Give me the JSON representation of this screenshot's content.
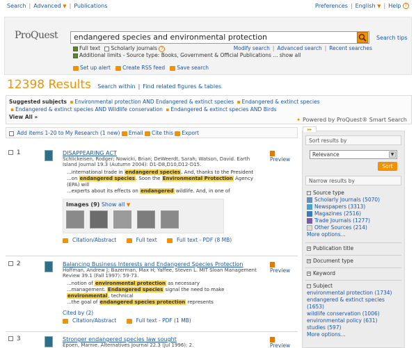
{
  "header": {
    "search": "Search",
    "advanced": "Advanced",
    "publications": "Publications",
    "preferences": "Preferences",
    "language": "English",
    "help": "Help"
  },
  "logo": "ProQuest",
  "search": {
    "query": "endangered species and environmental protection",
    "tips": "Search tips",
    "full_text": "Full text",
    "scholarly": "Scholarly journals",
    "additional_limits": "Additional limits - Source type: Books, Government & Official Publications ... show all",
    "modify": "Modify search",
    "advanced_search": "Advanced search",
    "recent": "Recent searches",
    "set_alert": "Set up alert",
    "rss": "Create RSS feed",
    "save": "Save search"
  },
  "results": {
    "count": "12398 Results",
    "search_within": "Search within",
    "find_related": "Find related figures & tables"
  },
  "suggested": {
    "label": "Suggested subjects",
    "items": [
      "Environmental protection AND Endangered & extinct species",
      "Endangered & extinct species",
      "Endangered & extinct species AND Wildlife conservation",
      "Endangered & extinct species AND Birds"
    ],
    "view_all": "View All »",
    "powered_by": "Powered by ProQuest® Smart Search"
  },
  "list_header": {
    "add_items": "Add items 1-20 to My Research (1 new)",
    "email": "Email",
    "cite": "Cite this",
    "export": "Export"
  },
  "items": [
    {
      "num": "1",
      "title": "DISAPPEARING ACT",
      "meta": "Schlickeisen, Rodger; Nowicki, Brian; DeWeerdt, Sarah; Watson, David. Earth Island Journal 19.3 (Autumn 2004): D1-D8,D10,D12-D15.",
      "preview": "Preview",
      "images_label": "Images (9)",
      "show_all": "Show all",
      "links": [
        "Citation/Abstract",
        "Full text",
        "Full text - PDF (8 MB)"
      ]
    },
    {
      "num": "2",
      "title": "Balancing Business Interests and Endangered Species Protection",
      "meta": "Hoffman, Andrew J; Bazerman, Max H; Yaffee, Steven L. MIT Sloan Management Review 39.1 (Fall 1997): 59-73.",
      "preview": "Preview",
      "cited_by": "Cited by (2)",
      "links": [
        "Citation/Abstract",
        "Full text - PDF (1 MB)"
      ]
    },
    {
      "num": "3",
      "title": "Stronger endangered species law sought",
      "meta": "Epoen, Marnie. Alternatives Journal 22.3 (Jul 1996): 2.",
      "preview": "Preview"
    }
  ],
  "snippet1": {
    "l1a": "...international trade in ",
    "l1h": "endangered species",
    "l1b": ". And, thanks to the President",
    "l2a": "...on ",
    "l2h": "endangered species",
    "l2b": ". Soon the ",
    "l2h2": "Environmental Protection",
    "l2c": " Agency (EPA) will",
    "l3a": "...experts about its effects on ",
    "l3h": "endangered",
    "l3b": " wildlife. And, in one of"
  },
  "snippet2": {
    "l1a": "...notion of ",
    "l1h": "environmental protection",
    "l1b": " as necessary",
    "l2a": "...management. ",
    "l2h": "Endangered species",
    "l2b": " signal the need to make ",
    "l2h2": "environmental",
    "l2c": ", technical",
    "l3a": "...the goal of ",
    "l3h": "endangered species protection",
    "l3b": " represents"
  },
  "sidebar": {
    "sort_header": "Sort results by",
    "sort_value": "Relevance",
    "sort_button": "Sort",
    "narrow_header": "Narrow results by",
    "source_type": "Source type",
    "sources": [
      {
        "icon": "scholarly-journals-icon",
        "label": "Scholarly Journals",
        "count": "(5070)"
      },
      {
        "icon": "newspapers-icon",
        "label": "Newspapers",
        "count": "(3313)"
      },
      {
        "icon": "magazines-icon",
        "label": "Magazines",
        "count": "(2516)"
      },
      {
        "icon": "trade-journals-icon",
        "label": "Trade Journals",
        "count": "(1277)"
      },
      {
        "icon": "other-sources-icon",
        "label": "Other Sources",
        "count": "(214)"
      }
    ],
    "more_options": "More options...",
    "publication_title": "Publication title",
    "document_type": "Document type",
    "keyword": "Keyword",
    "subject": "Subject",
    "subjects": [
      "environmental protection (1734)",
      "endangered & extinct species (1653)",
      "wildlife conservation (1006)",
      "environmental policy (631)",
      "studies (597)"
    ],
    "more_options2": "More options..."
  }
}
